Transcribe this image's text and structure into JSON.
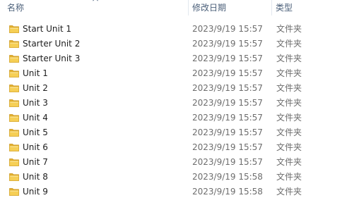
{
  "columns": {
    "name": "名称",
    "date": "修改日期",
    "type": "类型"
  },
  "rows": [
    {
      "name": "Start Unit 1",
      "date": "2023/9/19 15:57",
      "type": "文件夹",
      "icon": "folder-icon"
    },
    {
      "name": "Starter Unit 2",
      "date": "2023/9/19 15:57",
      "type": "文件夹",
      "icon": "folder-icon"
    },
    {
      "name": "Starter Unit 3",
      "date": "2023/9/19 15:57",
      "type": "文件夹",
      "icon": "folder-icon"
    },
    {
      "name": "Unit 1",
      "date": "2023/9/19 15:57",
      "type": "文件夹",
      "icon": "folder-icon"
    },
    {
      "name": "Unit 2",
      "date": "2023/9/19 15:57",
      "type": "文件夹",
      "icon": "folder-icon"
    },
    {
      "name": "Unit 3",
      "date": "2023/9/19 15:57",
      "type": "文件夹",
      "icon": "folder-icon"
    },
    {
      "name": "Unit 4",
      "date": "2023/9/19 15:57",
      "type": "文件夹",
      "icon": "folder-icon"
    },
    {
      "name": "Unit 5",
      "date": "2023/9/19 15:57",
      "type": "文件夹",
      "icon": "folder-icon"
    },
    {
      "name": "Unit 6",
      "date": "2023/9/19 15:57",
      "type": "文件夹",
      "icon": "folder-icon"
    },
    {
      "name": "Unit 7",
      "date": "2023/9/19 15:57",
      "type": "文件夹",
      "icon": "folder-icon"
    },
    {
      "name": "Unit 8",
      "date": "2023/9/19 15:58",
      "type": "文件夹",
      "icon": "folder-icon"
    },
    {
      "name": "Unit 9",
      "date": "2023/9/19 15:58",
      "type": "文件夹",
      "icon": "folder-icon"
    }
  ],
  "colors": {
    "header_text": "#4c607a",
    "name_text": "#1e1e1e",
    "detail_text": "#6d6d6d",
    "folder_yellow": "#f3c743",
    "sort_arrow": "#5a6d86"
  }
}
